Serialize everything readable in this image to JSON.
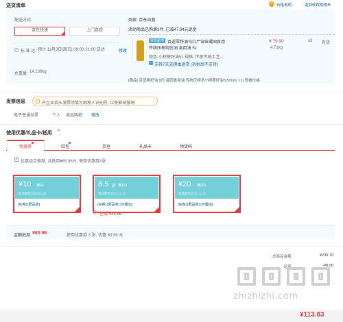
{
  "header": {
    "title": "送货清单",
    "price_desc": "价格说明",
    "back_cart": "返回修改购物车"
  },
  "delivery": {
    "label": "配送方式",
    "mode_jd": "京东快递",
    "mode_pickup": "上门自提",
    "ship_time_label": "标 准 达:",
    "ship_time_value": "预计 11月3日[周五] 09:00-21:00 送达",
    "modify": "修改",
    "total_weight_label": "总重量:",
    "total_weight_value": "14.136kg"
  },
  "seller": {
    "label": "商家: 京东自营",
    "promo": "活动商品已购满3件, 已减47.94元现金",
    "tag": "京东超市",
    "product_name_1": "百适零籽油马口尸含味凝固食用",
    "product_name_2": "传统压榨纯仿油 食用油 5L",
    "price": "¥ 79.90",
    "qty": "x3",
    "stock": "有货",
    "weight": "4.71kg",
    "color_label": "颜色:",
    "color_value": "小榨葵籽油5L  规格: 传承传统工艺...",
    "service": "支持7天无理由退货 (拆封后不支持)",
    "gift": "[赠品]  百适零籽油 8日 凝固食用油 传统压榨多小榨葵籽油5(500ml ×1)  查看价格"
  },
  "invoice": {
    "title": "发票信息",
    "tip": "开企业抬头发票须填写纳税人识别号, 以免影响报销",
    "type": "电子普通发票",
    "person": "个人",
    "detail": "商品明细",
    "modify": "修改"
  },
  "coupons": {
    "title": "使用优惠/礼品卡/抵用",
    "tabs": [
      "优惠券",
      "红包",
      "京豆",
      "礼品卡",
      "领货码"
    ],
    "check_label": "优惠组合推荐, 共抵用¥65.96元: 使用优惠券3张",
    "items": [
      {
        "amount": "¥10",
        "cond": "满69",
        "date": "有效期至2023-11-04",
        "links": "[东券]  [限品类]"
      },
      {
        "amount": "8.5",
        "unit": "折",
        "cond": "满169",
        "date": "有效期至2023-11-04",
        "links": "[东券]  [限品类]  [可叠加]",
        "saved": "已减 ¥35.86"
      },
      {
        "amount": "¥20",
        "cond": "满200",
        "date": "有效期至2023-11-02",
        "links": "[东券]  [限品类]  [可叠加]"
      }
    ],
    "summary_label": "金额抵用",
    "summary_value": "¥65.96",
    "summary_note": "使用优惠券 3 张, 优惠 65.96 元"
  },
  "totals": {
    "items_label": "总商品金额:",
    "items_value": "¥239.70",
    "return_label": "返现:",
    "return_value": "-¥0.00",
    "payable_value": "¥113.83"
  },
  "watermark": "zhizhizhi.com"
}
